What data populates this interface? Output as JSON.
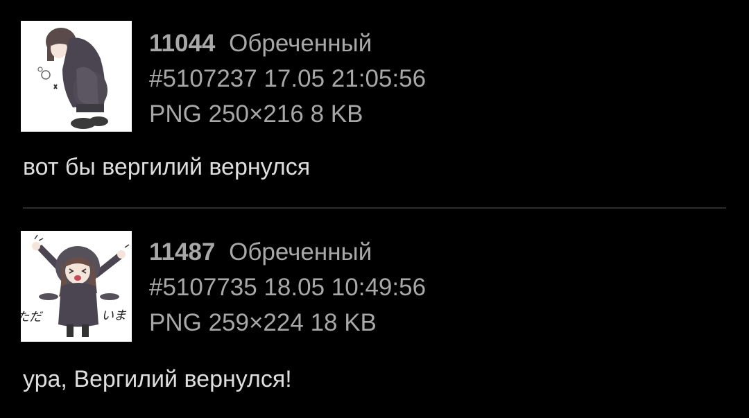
{
  "posts": [
    {
      "post_number": "11044",
      "author": "Обреченный",
      "post_id": "#5107237",
      "date": "17.05",
      "time": "21:05:56",
      "file_format": "PNG",
      "file_dimensions": "250×216",
      "file_size": "8 KB",
      "comment": "вот бы вергилий вернулся"
    },
    {
      "post_number": "11487",
      "author": "Обреченный",
      "post_id": "#5107735",
      "date": "18.05",
      "time": "10:49:56",
      "file_format": "PNG",
      "file_dimensions": "259×224",
      "file_size": "18 KB",
      "comment": "ура, Вергилий вернулся!",
      "thumb_caption_left": "ただ",
      "thumb_caption_right": "いま"
    }
  ],
  "colors": {
    "background": "#000000",
    "meta_text": "#a8a8a8",
    "comment_text": "#dedede",
    "divider": "#2c2c2c"
  }
}
